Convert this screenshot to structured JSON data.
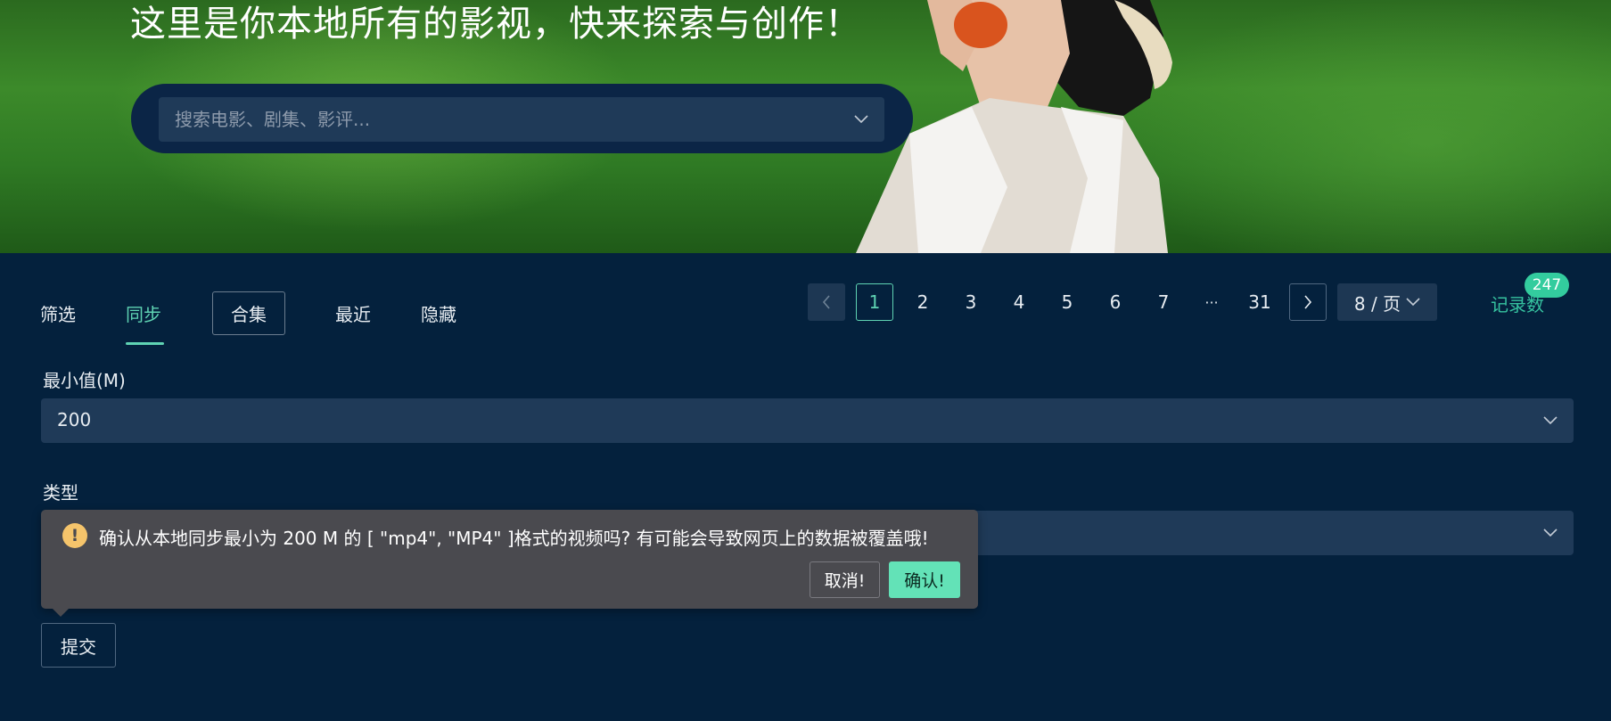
{
  "hero": {
    "title": "这里是你本地所有的影视，快来探索与创作！",
    "search_placeholder": "搜索电影、剧集、影评..."
  },
  "tabs": [
    {
      "label": "筛选",
      "active": false
    },
    {
      "label": "同步",
      "active": true
    },
    {
      "label": "合集",
      "active": false
    },
    {
      "label": "最近",
      "active": false
    },
    {
      "label": "隐藏",
      "active": false
    }
  ],
  "pagination": {
    "pages": [
      "1",
      "2",
      "3",
      "4",
      "5",
      "6",
      "7",
      "···",
      "31"
    ],
    "current": "1",
    "page_size": "8 / 页"
  },
  "record": {
    "label": "记录数",
    "count": "247"
  },
  "form": {
    "min_label": "最小值(M)",
    "min_value": "200",
    "type_label": "类型",
    "submit": "提交"
  },
  "popconfirm": {
    "message": "确认从本地同步最小为 200 M 的 [ \"mp4\", \"MP4\" ]格式的视频吗? 有可能会导致网页上的数据被覆盖哦!",
    "cancel": "取消!",
    "confirm": "确认!",
    "icon": "warning-icon"
  },
  "colors": {
    "background": "#04213d",
    "accent": "#5fd3b3",
    "input_bg": "#1f3a58",
    "popover_bg": "#4a4a4f",
    "confirm_btn": "#63e2b7",
    "warning": "#f5c46b"
  }
}
